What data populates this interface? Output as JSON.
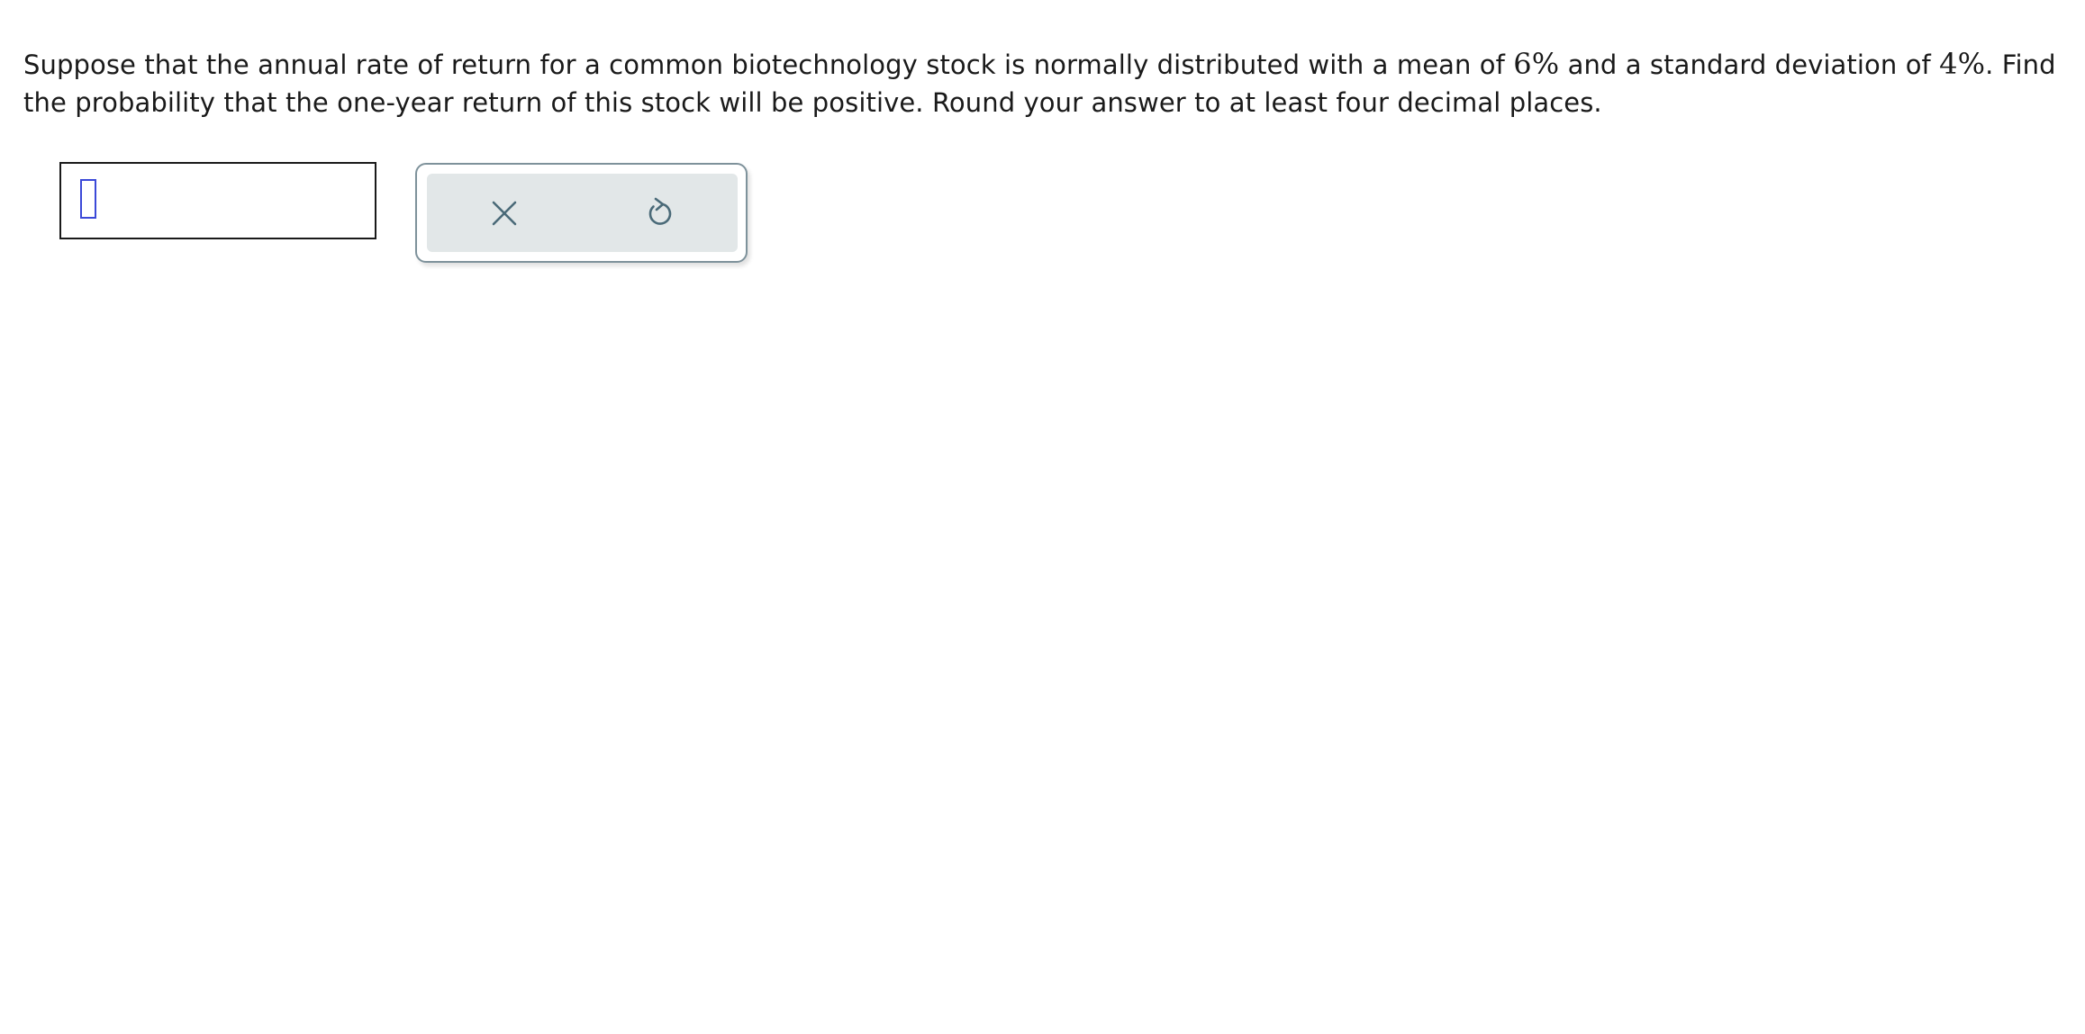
{
  "question": {
    "text_1": "Suppose that the annual rate of return for a common biotechnology stock is normally distributed with a mean of ",
    "mean": "6%",
    "text_2": " and a standard deviation of ",
    "std_dev": "4%",
    "text_3": ". Find the probability that the one-year return of this stock will be positive. Round your answer to at least four decimal places."
  },
  "answer": {
    "value": ""
  },
  "tools": {
    "clear_icon": "close-icon",
    "undo_icon": "undo-icon",
    "icon_color": "#4a6a78",
    "cursor_color": "#3b49d8"
  }
}
